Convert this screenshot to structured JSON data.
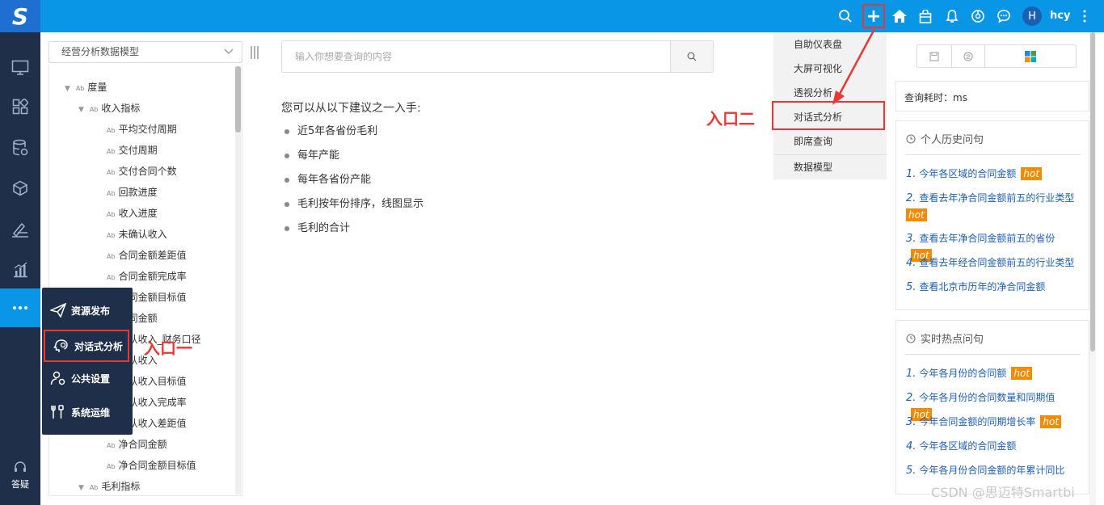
{
  "topbar": {
    "logo": "S",
    "user_initial": "H",
    "user_name": "hcy",
    "icons": [
      "search-icon",
      "plus-icon",
      "home-icon",
      "store-icon",
      "bell-icon",
      "gauge-icon",
      "chat-icon",
      "more-vertical-icon"
    ]
  },
  "leftnav": {
    "items": [
      "monitor-icon",
      "apps-icon",
      "database-icon",
      "cube-icon",
      "pen-icon",
      "chart-icon",
      "more-icon"
    ],
    "help_label": "答疑"
  },
  "popup_menu": {
    "items": [
      {
        "label": "资源发布",
        "icon": "send-icon"
      },
      {
        "label": "对话式分析",
        "icon": "brain-icon"
      },
      {
        "label": "公共设置",
        "icon": "user-gear-icon"
      },
      {
        "label": "系统运维",
        "icon": "tools-icon"
      }
    ]
  },
  "model_panel": {
    "selected_model": "经营分析数据模型",
    "tree": [
      {
        "label": "度量",
        "level": 0,
        "toggle": true
      },
      {
        "label": "收入指标",
        "level": 1,
        "toggle": true
      },
      {
        "label": "平均交付周期",
        "level": 2
      },
      {
        "label": "交付周期",
        "level": 2
      },
      {
        "label": "交付合同个数",
        "level": 2
      },
      {
        "label": "回款进度",
        "level": 2
      },
      {
        "label": "收入进度",
        "level": 2
      },
      {
        "label": "未确认收入",
        "level": 2
      },
      {
        "label": "合同金额差距值",
        "level": 2
      },
      {
        "label": "合同金额完成率",
        "level": 2
      },
      {
        "label": "合同金额目标值",
        "level": 2
      },
      {
        "label": "合同金额",
        "level": 2
      },
      {
        "label": "确认收入_财务口径",
        "level": 2
      },
      {
        "label": "确认收入",
        "level": 2
      },
      {
        "label": "确认收入目标值",
        "level": 2
      },
      {
        "label": "确认收入完成率",
        "level": 2
      },
      {
        "label": "确认收入差距值",
        "level": 2
      },
      {
        "label": "净合同金额",
        "level": 2
      },
      {
        "label": "净合同金额目标值",
        "level": 2
      },
      {
        "label": "毛利指标",
        "level": 1,
        "toggle": true
      }
    ]
  },
  "search": {
    "placeholder": "输入你想要查询的内容"
  },
  "suggestions": {
    "title": "您可以从以下建议之一入手:",
    "items": [
      "近5年各省份毛利",
      "每年产能",
      "每年各省份产能",
      "毛利按年份排序，线图显示",
      "毛利的合计"
    ]
  },
  "create_dropdown": {
    "items": [
      "自助仪表盘",
      "大屏可视化",
      "透视分析",
      "对话式分析",
      "即席查询",
      "数据模型"
    ]
  },
  "annotations": {
    "entry_one": "入口一",
    "entry_two": "入口二",
    "color": "#e53935"
  },
  "right_panel": {
    "query_time": "查询耗时：ms",
    "history_title": "个人历史问句",
    "history": [
      {
        "num": "1.",
        "text": "今年各区域的合同金额",
        "hot": true
      },
      {
        "num": "2.",
        "text": "查看去年净合同金额前五的行业类型",
        "hot": true
      },
      {
        "num": "3.",
        "text": "查看去年净合同金额前五的省份",
        "hot": true
      },
      {
        "num": "4.",
        "text": "查看去年经合同金额前五的行业类型",
        "hot": false
      },
      {
        "num": "5.",
        "text": "查看北京市历年的净合同金额",
        "hot": false
      }
    ],
    "hot_title": "实时热点问句",
    "hot_questions": [
      {
        "num": "1.",
        "text": "今年各月份的合同额",
        "hot": true
      },
      {
        "num": "2.",
        "text": "今年各月份的合同数量和同期值",
        "hot": true
      },
      {
        "num": "3.",
        "text": "今年合同金额的同期增长率",
        "hot": true
      },
      {
        "num": "4.",
        "text": "今年各区域的合同金额",
        "hot": false
      },
      {
        "num": "5.",
        "text": "今年各月份合同金额的年累计同比",
        "hot": false
      }
    ],
    "hot_badge": "hot"
  },
  "watermark": "CSDN @思迈特Smartbi",
  "colors": {
    "topbar": "#0a96e6",
    "nav": "#1f2f4a",
    "accent": "#0a96e6",
    "hot": "#f28b00",
    "link": "#1c5fb0"
  }
}
